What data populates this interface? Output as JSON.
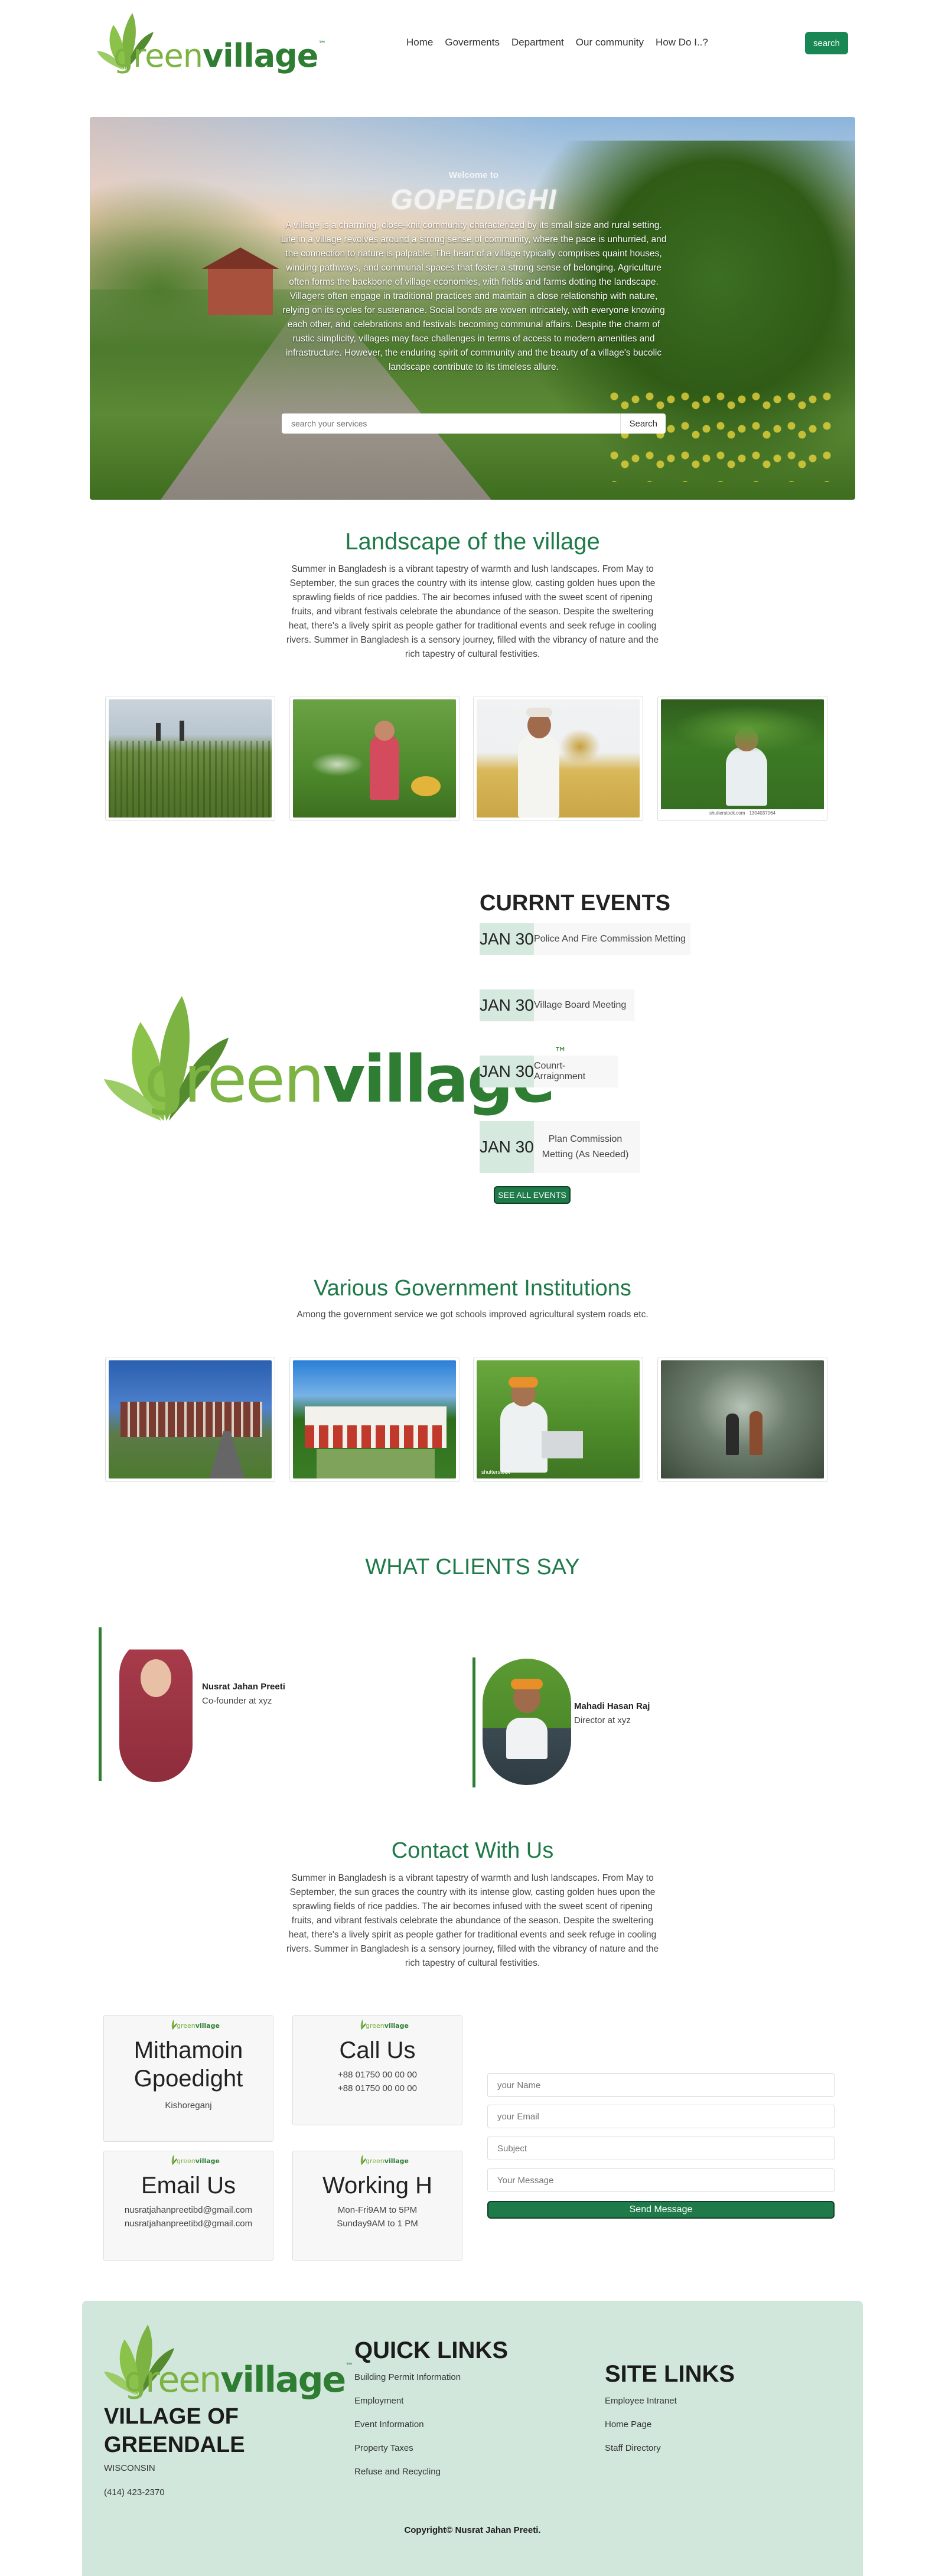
{
  "header": {
    "logo_part1": "green",
    "logo_part2": "village",
    "logo_tm": "™",
    "nav": [
      "Home",
      "Goverments",
      "Department",
      "Our community",
      "How Do I..?"
    ],
    "search_label": "search"
  },
  "hero": {
    "welcome": "Welcome to",
    "title": "GOPEDIGHI",
    "text": "A village is a charming, close-knit community characterized by its small size and rural setting. Life in a village revolves around a strong sense of community, where the pace is unhurried, and the connection to nature is palpable. The heart of a village typically comprises quaint houses, winding pathways, and communal spaces that foster a strong sense of belonging. Agriculture often forms the backbone of village economies, with fields and farms dotting the landscape. Villagers often engage in traditional practices and maintain a close relationship with nature, relying on its cycles for sustenance. Social bonds are woven intricately, with everyone knowing each other, and celebrations and festivals becoming communal affairs. Despite the charm of rustic simplicity, villages may face challenges in terms of access to modern amenities and infrastructure. However, the enduring spirit of community and the beauty of a village's bucolic landscape contribute to its timeless allure.",
    "search_placeholder": "search your services",
    "search_button": "Search"
  },
  "landscape": {
    "title": "Landscape of the village",
    "text": "Summer in Bangladesh is a vibrant tapestry of warmth and lush landscapes. From May to September, the sun graces the country with its intense glow, casting golden hues upon the sprawling fields of rice paddies. The air becomes infused with the sweet scent of ripening fruits, and vibrant festivals celebrate the abundance of the season. Despite the sweltering heat, there's a lively spirit as people gather for traditional events and seek refuge in cooling rivers. Summer in Bangladesh is a sensory journey, filled with the vibrancy of nature and the rich tapestry of cultural festivities.",
    "photo_caption": "shutterstock.com · 1304037064"
  },
  "events": {
    "title": "CURRNT EVENTS",
    "items": [
      {
        "date": "JAN 30",
        "name": "Police And Fire Commission Metting"
      },
      {
        "date": "JAN 30",
        "name": "Village Board Meeting"
      },
      {
        "date": "JAN 30",
        "name": "Counrt-Arraignment"
      },
      {
        "date": "JAN 30",
        "name": "Plan Commission Metting (As Needed)"
      }
    ],
    "see_all": "SEE ALL EVENTS"
  },
  "institutions": {
    "title": "Various Government Institutions",
    "text": "Among the government service we got schools improved agricultural system roads etc.",
    "photo_caption": "shutterstock"
  },
  "clients": {
    "title": "WHAT CLIENTS SAY",
    "items": [
      {
        "name": "Nusrat Jahan Preeti",
        "role": "Co-founder at xyz"
      },
      {
        "name": "Mahadi Hasan Raj",
        "role": "Director at xyz"
      }
    ]
  },
  "contact": {
    "title": "Contact With Us",
    "text": "Summer in Bangladesh is a vibrant tapestry of warmth and lush landscapes. From May to September, the sun graces the country with its intense glow, casting golden hues upon the sprawling fields of rice paddies. The air becomes infused with the sweet scent of ripening fruits, and vibrant festivals celebrate the abundance of the season. Despite the sweltering heat, there's a lively spirit as people gather for traditional events and seek refuge in cooling rivers. Summer in Bangladesh is a sensory journey, filled with the vibrancy of nature and the rich tapestry of cultural festivities.",
    "cards": [
      {
        "title": "Mithamoin Gpoedight",
        "lines": [
          "Kishoreganj"
        ]
      },
      {
        "title": "Call Us",
        "lines": [
          "+88 01750 00 00 00",
          "+88 01750 00 00 00"
        ]
      },
      {
        "title": "Email Us",
        "lines": [
          "nusratjahanpreetibd@gmail.com",
          "nusratjahanpreetibd@gmail.com"
        ]
      },
      {
        "title": "Working H",
        "lines": [
          "Mon-Fri9AM to 5PM",
          "Sunday9AM to 1 PM"
        ]
      }
    ],
    "form": {
      "name_placeholder": "your Name",
      "email_placeholder": "your Email",
      "subject_placeholder": "Subject",
      "message_placeholder": "Your Message",
      "send_label": "Send Message"
    }
  },
  "footer": {
    "village": "VILLAGE OF GREENDALE",
    "state": "WISCONSIN",
    "phone": "(414) 423-2370",
    "quick_title": "QUICK LINKS",
    "quick_links": [
      "Building Permit Information",
      "Employment",
      "Event Information",
      "Property Taxes",
      "Refuse and Recycling"
    ],
    "site_title": "SITE LINKS",
    "site_links": [
      "Employee Intranet",
      "Home Page",
      "Staff Directory"
    ],
    "copyright": "Copyright© Nusrat Jahan Preeti."
  },
  "colors": {
    "brand_green": "#198754",
    "heading_green": "#1f7a4a",
    "footer_bg": "#d1e7dc",
    "logo_light": "#7cb342",
    "logo_dark": "#2e7d32"
  }
}
